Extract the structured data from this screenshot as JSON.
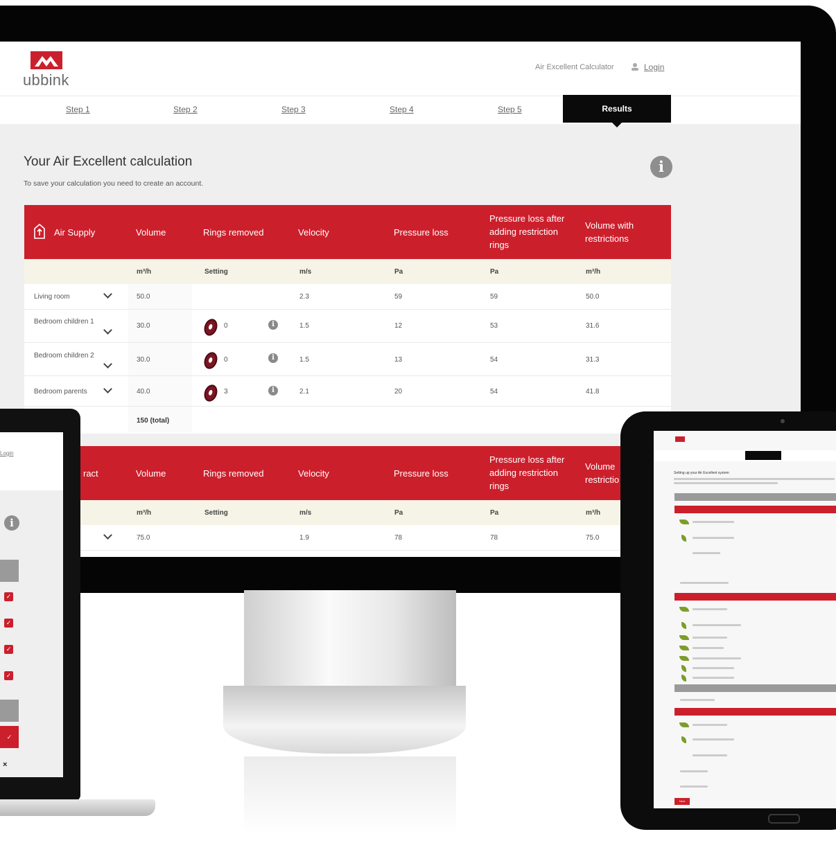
{
  "app": {
    "brand": "ubbink",
    "header_link": "Air Excellent Calculator",
    "login": "Login"
  },
  "steps": [
    "Step 1",
    "Step 2",
    "Step 3",
    "Step 4",
    "Step 5"
  ],
  "active_step": "Results",
  "page": {
    "title": "Your Air Excellent calculation",
    "subtitle": "To save your calculation you need to create an account."
  },
  "supply": {
    "heading": "Air Supply",
    "columns": [
      "Volume",
      "Rings removed",
      "Velocity",
      "Pressure loss",
      "Pressure loss after adding restriction rings",
      "Volume with restrictions"
    ],
    "units": [
      "m³/h",
      "Setting",
      "m/s",
      "Pa",
      "Pa",
      "m³/h"
    ],
    "rows": [
      {
        "room": "Living room",
        "volume": "50.0",
        "rings": "",
        "velocity": "2.3",
        "ploss": "59",
        "ploss_rings": "59",
        "vol_restr": "50.0"
      },
      {
        "room": "Bedroom children 1",
        "volume": "30.0",
        "rings": "0",
        "velocity": "1.5",
        "ploss": "12",
        "ploss_rings": "53",
        "vol_restr": "31.6"
      },
      {
        "room": "Bedroom children 2",
        "volume": "30.0",
        "rings": "0",
        "velocity": "1.5",
        "ploss": "13",
        "ploss_rings": "54",
        "vol_restr": "31.3"
      },
      {
        "room": "Bedroom parents",
        "volume": "40.0",
        "rings": "3",
        "velocity": "2.1",
        "ploss": "20",
        "ploss_rings": "54",
        "vol_restr": "41.8"
      }
    ],
    "total": "150 (total)"
  },
  "extract": {
    "heading": "ract",
    "columns": [
      "Volume",
      "Rings removed",
      "Velocity",
      "Pressure loss",
      "Pressure loss after adding restriction rings",
      "Volume restrictio"
    ],
    "units": [
      "m³/h",
      "Setting",
      "m/s",
      "Pa",
      "Pa",
      "m³/h"
    ],
    "rows": [
      {
        "volume": "75.0",
        "velocity": "1.9",
        "ploss": "78",
        "ploss_rings": "78",
        "vol_restr": "75.0"
      }
    ]
  },
  "laptop": {
    "login": "Login"
  },
  "tablet": {
    "title": "Setting up your Air Excellent system",
    "button": "Next"
  },
  "colors": {
    "accent": "#cc1f2c",
    "unit_row": "#f5f4e6",
    "bezel": "#050505"
  }
}
